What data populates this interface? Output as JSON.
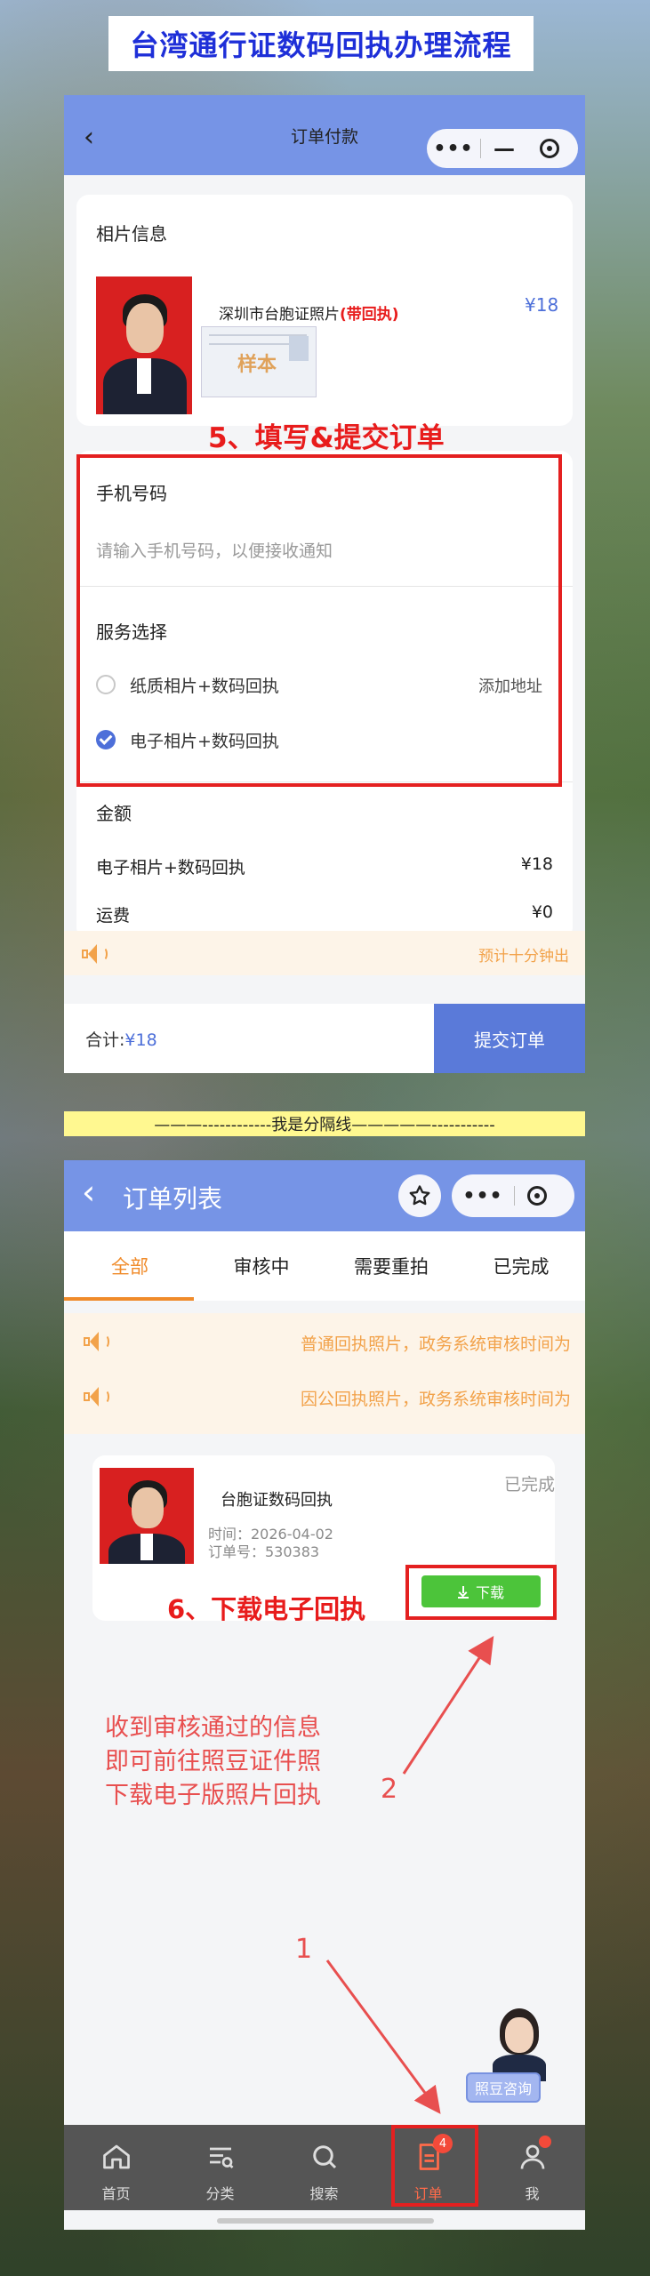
{
  "banner": {
    "title": "台湾通行证数码回执办理流程"
  },
  "screen1": {
    "nav": {
      "title": "订单付款"
    },
    "photo_section": {
      "title": "相片信息",
      "product_name": "深圳市台胞证照片",
      "product_tag": "(带回执)",
      "price": "¥18",
      "sample_label": "样本"
    },
    "step5": "5、填写&提交订单",
    "phone": {
      "title": "手机号码",
      "placeholder": "请输入手机号码，以便接收通知"
    },
    "service": {
      "title": "服务选择",
      "options": [
        {
          "label": "纸质相片+数码回执",
          "selected": false,
          "extra": "添加地址"
        },
        {
          "label": "电子相片+数码回执",
          "selected": true,
          "extra": ""
        }
      ]
    },
    "amount": {
      "title": "金额",
      "rows": [
        {
          "label": "电子相片+数码回执",
          "value": "¥18"
        },
        {
          "label": "运费",
          "value": "¥0"
        }
      ]
    },
    "notice": "预计十分钟出",
    "footer": {
      "total_label": "合计:",
      "total_value": "¥18",
      "submit": "提交订单"
    }
  },
  "separator": {
    "text": "———------------我是分隔线—————-----------"
  },
  "screen2": {
    "nav": {
      "title": "订单列表"
    },
    "tabs": [
      {
        "label": "全部",
        "active": true
      },
      {
        "label": "审核中",
        "active": false
      },
      {
        "label": "需要重拍",
        "active": false
      },
      {
        "label": "已完成",
        "active": false
      }
    ],
    "notices": [
      "普通回执照片，政务系统审核时间为",
      "因公回执照片，政务系统审核时间为"
    ],
    "order": {
      "name": "台胞证数码回执",
      "status": "已完成",
      "time": "时间：2026-04-02",
      "order_no": "订单号：530383",
      "download": "下载"
    },
    "step6": "6、下载电子回执",
    "hint": [
      "收到审核通过的信息",
      "即可前往照豆证件照",
      "下载电子版照片回执"
    ],
    "arrow_labels": {
      "one": "1",
      "two": "2"
    },
    "help_chip": "照豆咨询",
    "tabbar": [
      {
        "label": "首页",
        "icon": "home-icon"
      },
      {
        "label": "分类",
        "icon": "category-icon"
      },
      {
        "label": "搜索",
        "icon": "search-icon"
      },
      {
        "label": "订单",
        "icon": "order-icon",
        "badge": "4",
        "active": true
      },
      {
        "label": "我",
        "icon": "user-icon"
      }
    ]
  },
  "colors": {
    "nav_blue": "#7694e6",
    "accent_red": "#e42020",
    "orange": "#f08b2a",
    "download_green": "#4cc43a"
  }
}
